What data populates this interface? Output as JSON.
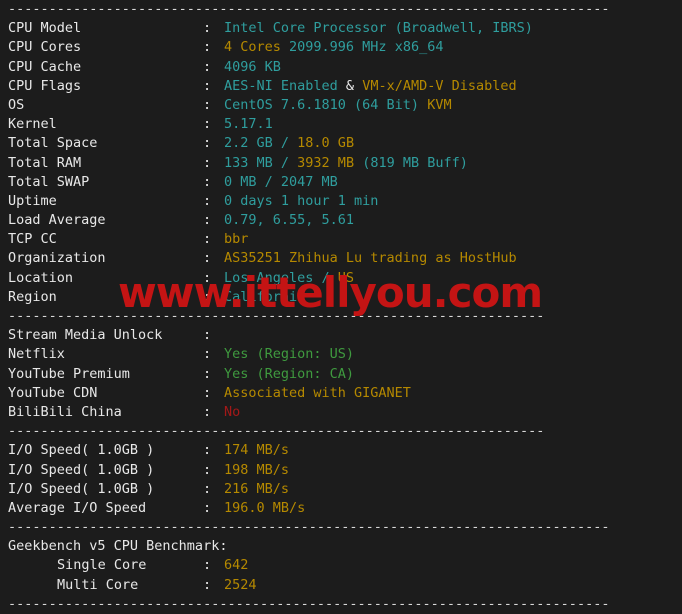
{
  "terminal": {
    "separator_line": "--------------------------------------------------------------------------",
    "separator_short": "------------------------------------------------------------------",
    "colon": ":",
    "watermark": "www.ittellyou.com"
  },
  "system_info": [
    {
      "label": "CPU Model",
      "parts": [
        {
          "text": "Intel Core Processor (Broadwell, IBRS)",
          "color": "cyan"
        }
      ]
    },
    {
      "label": "CPU Cores",
      "parts": [
        {
          "text": "4 Cores ",
          "color": "yellow"
        },
        {
          "text": "2099.996 MHz x86_64",
          "color": "cyan"
        }
      ]
    },
    {
      "label": "CPU Cache",
      "parts": [
        {
          "text": "4096 KB",
          "color": "cyan"
        }
      ]
    },
    {
      "label": "CPU Flags",
      "parts": [
        {
          "text": "AES-NI Enabled",
          "color": "cyan"
        },
        {
          "text": " & ",
          "color": "white"
        },
        {
          "text": "VM-x/AMD-V Disabled",
          "color": "yellow"
        }
      ]
    },
    {
      "label": "OS",
      "parts": [
        {
          "text": "CentOS 7.6.1810 (64 Bit) ",
          "color": "cyan"
        },
        {
          "text": "KVM",
          "color": "yellow"
        }
      ]
    },
    {
      "label": "Kernel",
      "parts": [
        {
          "text": "5.17.1",
          "color": "cyan"
        }
      ]
    },
    {
      "label": "Total Space",
      "parts": [
        {
          "text": "2.2 GB ",
          "color": "cyan"
        },
        {
          "text": "/ ",
          "color": "cyan"
        },
        {
          "text": "18.0 GB",
          "color": "yellow"
        }
      ]
    },
    {
      "label": "Total RAM",
      "parts": [
        {
          "text": "133 MB ",
          "color": "cyan"
        },
        {
          "text": "/ ",
          "color": "cyan"
        },
        {
          "text": "3932 MB ",
          "color": "yellow"
        },
        {
          "text": "(819 MB Buff)",
          "color": "cyan"
        }
      ]
    },
    {
      "label": "Total SWAP",
      "parts": [
        {
          "text": "0 MB / 2047 MB",
          "color": "cyan"
        }
      ]
    },
    {
      "label": "Uptime",
      "parts": [
        {
          "text": "0 days 1 hour 1 min",
          "color": "cyan"
        }
      ]
    },
    {
      "label": "Load Average",
      "parts": [
        {
          "text": "0.79, 6.55, 5.61",
          "color": "cyan"
        }
      ]
    },
    {
      "label": "TCP CC",
      "parts": [
        {
          "text": "bbr",
          "color": "yellow"
        }
      ]
    },
    {
      "label": "Organization",
      "parts": [
        {
          "text": "AS35251 Zhihua Lu trading as HostHub",
          "color": "yellow"
        }
      ]
    },
    {
      "label": "Location",
      "parts": [
        {
          "text": "Los Angeles / ",
          "color": "cyan"
        },
        {
          "text": "US",
          "color": "yellow"
        }
      ]
    },
    {
      "label": "Region",
      "parts": [
        {
          "text": "California",
          "color": "cyan"
        }
      ]
    }
  ],
  "stream_media": {
    "heading_label": "Stream Media Unlock",
    "rows": [
      {
        "label": "Netflix",
        "parts": [
          {
            "text": "Yes (Region: US)",
            "color": "green"
          }
        ]
      },
      {
        "label": "YouTube Premium",
        "parts": [
          {
            "text": "Yes (Region: CA)",
            "color": "green"
          }
        ]
      },
      {
        "label": "YouTube CDN",
        "parts": [
          {
            "text": "Associated with GIGANET",
            "color": "yellow"
          }
        ]
      },
      {
        "label": "BiliBili China",
        "parts": [
          {
            "text": "No",
            "color": "red"
          }
        ]
      }
    ]
  },
  "io_speed": [
    {
      "label": "I/O Speed( 1.0GB )",
      "parts": [
        {
          "text": "174 MB/s",
          "color": "yellow"
        }
      ]
    },
    {
      "label": "I/O Speed( 1.0GB )",
      "parts": [
        {
          "text": "198 MB/s",
          "color": "yellow"
        }
      ]
    },
    {
      "label": "I/O Speed( 1.0GB )",
      "parts": [
        {
          "text": "216 MB/s",
          "color": "yellow"
        }
      ]
    },
    {
      "label": "Average I/O Speed",
      "parts": [
        {
          "text": "196.0 MB/s",
          "color": "yellow"
        }
      ]
    }
  ],
  "geekbench": {
    "heading": "Geekbench v5 CPU Benchmark:",
    "rows": [
      {
        "label": "Single Core",
        "parts": [
          {
            "text": "642",
            "color": "yellow"
          }
        ]
      },
      {
        "label": "Multi Core",
        "parts": [
          {
            "text": "2524",
            "color": "yellow"
          }
        ]
      }
    ]
  },
  "colors": {
    "background": "#1c1c1c",
    "label": "#e8e8e8",
    "cyan": "#2f9e9e",
    "yellow": "#b58900",
    "green": "#3f9a3f",
    "red": "#a31818",
    "watermark": "#c41414"
  }
}
